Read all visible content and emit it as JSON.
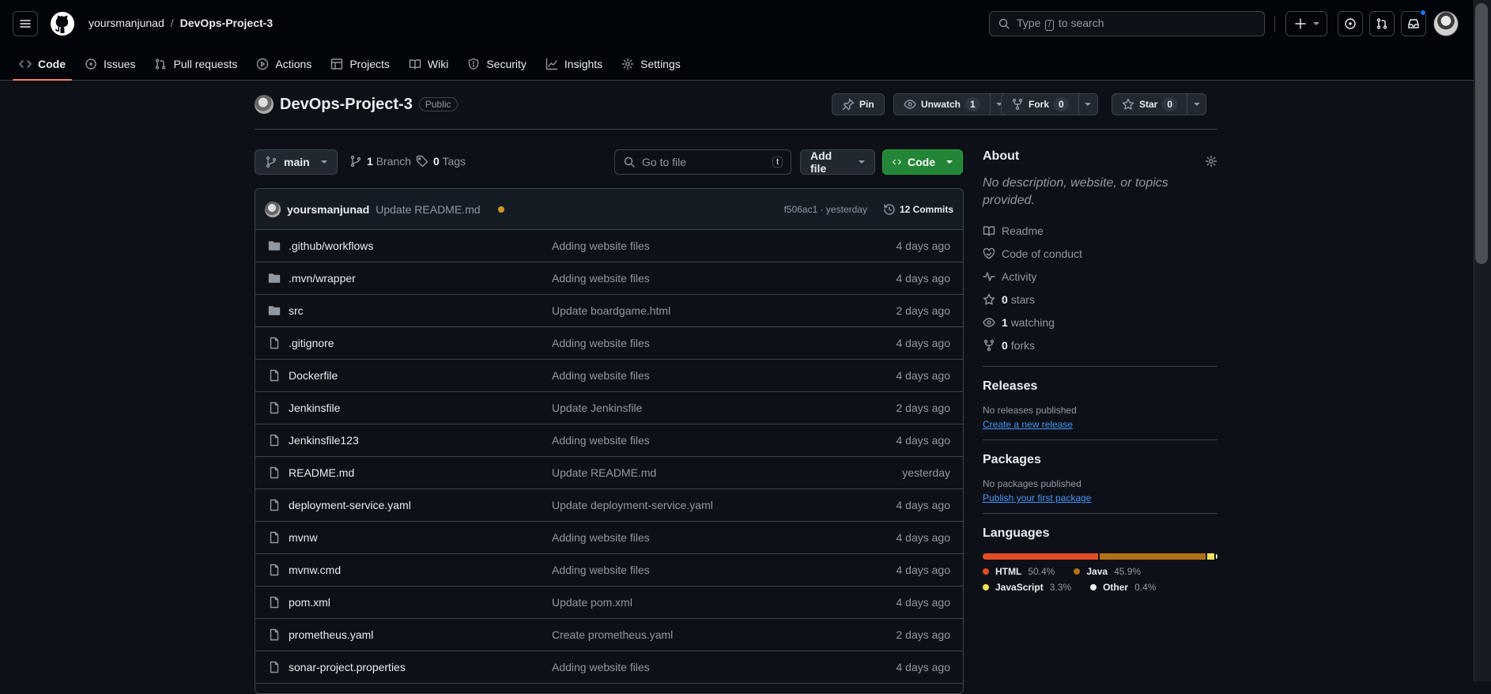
{
  "header": {
    "owner": "yoursmanjunad",
    "separator": "/",
    "repo": "DevOps-Project-3",
    "search_prefix": "Type",
    "search_key": "/",
    "search_suffix": "to search"
  },
  "nav": {
    "items": [
      {
        "label": "Code",
        "icon": "code-icon"
      },
      {
        "label": "Issues",
        "icon": "issue-icon"
      },
      {
        "label": "Pull requests",
        "icon": "pull-request-icon"
      },
      {
        "label": "Actions",
        "icon": "play-icon"
      },
      {
        "label": "Projects",
        "icon": "table-icon"
      },
      {
        "label": "Wiki",
        "icon": "book-icon"
      },
      {
        "label": "Security",
        "icon": "shield-icon"
      },
      {
        "label": "Insights",
        "icon": "graph-icon"
      },
      {
        "label": "Settings",
        "icon": "gear-icon"
      }
    ]
  },
  "repo_head": {
    "name": "DevOps-Project-3",
    "visibility": "Public",
    "pin": "Pin",
    "unwatch": "Unwatch",
    "watch_count": "1",
    "fork": "Fork",
    "fork_count": "0",
    "star": "Star",
    "star_count": "0"
  },
  "toolbar": {
    "branch": "main",
    "branch_count": "1",
    "branch_label": "Branch",
    "tag_count": "0",
    "tag_label": "Tags",
    "goto_placeholder": "Go to file",
    "goto_key": "t",
    "add_file": "Add file",
    "code": "Code"
  },
  "commit": {
    "user": "yoursmanjunad",
    "message": "Update README.md",
    "hash_time": "f506ac1 · yesterday",
    "commits": "12 Commits"
  },
  "files": [
    {
      "name": ".github/workflows",
      "type": "dir",
      "message": "Adding website files",
      "age": "4 days ago"
    },
    {
      "name": ".mvn/wrapper",
      "type": "dir",
      "message": "Adding website files",
      "age": "4 days ago"
    },
    {
      "name": "src",
      "type": "dir",
      "message": "Update boardgame.html",
      "age": "2 days ago"
    },
    {
      "name": ".gitignore",
      "type": "file",
      "message": "Adding website files",
      "age": "4 days ago"
    },
    {
      "name": "Dockerfile",
      "type": "file",
      "message": "Adding website files",
      "age": "4 days ago"
    },
    {
      "name": "Jenkinsfile",
      "type": "file",
      "message": "Update Jenkinsfile",
      "age": "2 days ago"
    },
    {
      "name": "Jenkinsfile123",
      "type": "file",
      "message": "Adding website files",
      "age": "4 days ago"
    },
    {
      "name": "README.md",
      "type": "file",
      "message": "Update README.md",
      "age": "yesterday"
    },
    {
      "name": "deployment-service.yaml",
      "type": "file",
      "message": "Update deployment-service.yaml",
      "age": "4 days ago"
    },
    {
      "name": "mvnw",
      "type": "file",
      "message": "Adding website files",
      "age": "4 days ago"
    },
    {
      "name": "mvnw.cmd",
      "type": "file",
      "message": "Adding website files",
      "age": "4 days ago"
    },
    {
      "name": "pom.xml",
      "type": "file",
      "message": "Update pom.xml",
      "age": "4 days ago"
    },
    {
      "name": "prometheus.yaml",
      "type": "file",
      "message": "Create prometheus.yaml",
      "age": "2 days ago"
    },
    {
      "name": "sonar-project.properties",
      "type": "file",
      "message": "Adding website files",
      "age": "4 days ago"
    },
    {
      "name": "",
      "type": "file",
      "message": "",
      "age": ""
    }
  ],
  "about": {
    "title": "About",
    "description": "No description, website, or topics provided.",
    "readme": "Readme",
    "conduct": "Code of conduct",
    "activity": "Activity",
    "stars_count": "0",
    "stars_label": "stars",
    "watching_count": "1",
    "watching_label": "watching",
    "forks_count": "0",
    "forks_label": "forks"
  },
  "releases": {
    "title": "Releases",
    "none": "No releases published",
    "create": "Create a new release"
  },
  "packages": {
    "title": "Packages",
    "none": "No packages published",
    "publish": "Publish your first package"
  },
  "languages": {
    "title": "Languages",
    "items": [
      {
        "name": "HTML",
        "percent": "50.4%",
        "value": 50.4,
        "color": "#e34c26"
      },
      {
        "name": "Java",
        "percent": "45.9%",
        "value": 45.9,
        "color": "#b07219"
      },
      {
        "name": "JavaScript",
        "percent": "3.3%",
        "value": 3.3,
        "color": "#f1e05a"
      },
      {
        "name": "Other",
        "percent": "0.4%",
        "value": 0.4,
        "color": "#ededed"
      }
    ]
  }
}
